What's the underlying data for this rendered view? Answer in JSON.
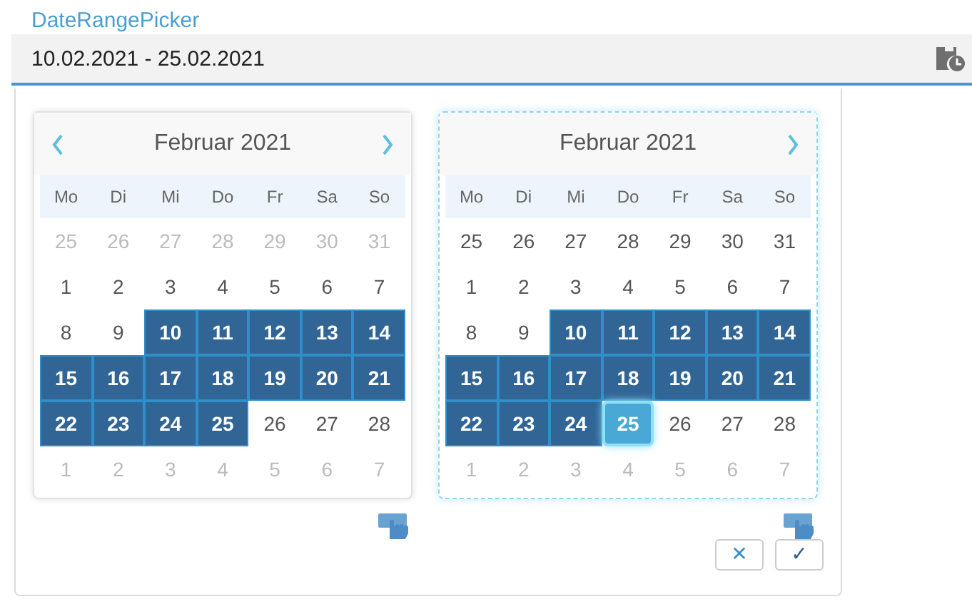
{
  "label": "DateRangePicker",
  "field": {
    "value": "10.02.2021 - 25.02.2021"
  },
  "calendars": [
    {
      "title": "Februar 2021",
      "prev": true,
      "next": true,
      "active": false,
      "weekdays": [
        "Mo",
        "Di",
        "Mi",
        "Do",
        "Fr",
        "Sa",
        "So"
      ],
      "weeks": [
        [
          {
            "day": "25",
            "outside": true,
            "selected": false,
            "focused": false
          },
          {
            "day": "26",
            "outside": true,
            "selected": false,
            "focused": false
          },
          {
            "day": "27",
            "outside": true,
            "selected": false,
            "focused": false
          },
          {
            "day": "28",
            "outside": true,
            "selected": false,
            "focused": false
          },
          {
            "day": "29",
            "outside": true,
            "selected": false,
            "focused": false
          },
          {
            "day": "30",
            "outside": true,
            "selected": false,
            "focused": false
          },
          {
            "day": "31",
            "outside": true,
            "selected": false,
            "focused": false
          }
        ],
        [
          {
            "day": "1",
            "outside": false,
            "selected": false,
            "focused": false
          },
          {
            "day": "2",
            "outside": false,
            "selected": false,
            "focused": false
          },
          {
            "day": "3",
            "outside": false,
            "selected": false,
            "focused": false
          },
          {
            "day": "4",
            "outside": false,
            "selected": false,
            "focused": false
          },
          {
            "day": "5",
            "outside": false,
            "selected": false,
            "focused": false
          },
          {
            "day": "6",
            "outside": false,
            "selected": false,
            "focused": false
          },
          {
            "day": "7",
            "outside": false,
            "selected": false,
            "focused": false
          }
        ],
        [
          {
            "day": "8",
            "outside": false,
            "selected": false,
            "focused": false
          },
          {
            "day": "9",
            "outside": false,
            "selected": false,
            "focused": false
          },
          {
            "day": "10",
            "outside": false,
            "selected": true,
            "focused": false
          },
          {
            "day": "11",
            "outside": false,
            "selected": true,
            "focused": false
          },
          {
            "day": "12",
            "outside": false,
            "selected": true,
            "focused": false
          },
          {
            "day": "13",
            "outside": false,
            "selected": true,
            "focused": false
          },
          {
            "day": "14",
            "outside": false,
            "selected": true,
            "focused": false
          }
        ],
        [
          {
            "day": "15",
            "outside": false,
            "selected": true,
            "focused": false
          },
          {
            "day": "16",
            "outside": false,
            "selected": true,
            "focused": false
          },
          {
            "day": "17",
            "outside": false,
            "selected": true,
            "focused": false
          },
          {
            "day": "18",
            "outside": false,
            "selected": true,
            "focused": false
          },
          {
            "day": "19",
            "outside": false,
            "selected": true,
            "focused": false
          },
          {
            "day": "20",
            "outside": false,
            "selected": true,
            "focused": false
          },
          {
            "day": "21",
            "outside": false,
            "selected": true,
            "focused": false
          }
        ],
        [
          {
            "day": "22",
            "outside": false,
            "selected": true,
            "focused": false
          },
          {
            "day": "23",
            "outside": false,
            "selected": true,
            "focused": false
          },
          {
            "day": "24",
            "outside": false,
            "selected": true,
            "focused": false
          },
          {
            "day": "25",
            "outside": false,
            "selected": true,
            "focused": false
          },
          {
            "day": "26",
            "outside": false,
            "selected": false,
            "focused": false
          },
          {
            "day": "27",
            "outside": false,
            "selected": false,
            "focused": false
          },
          {
            "day": "28",
            "outside": false,
            "selected": false,
            "focused": false
          }
        ],
        [
          {
            "day": "1",
            "outside": true,
            "selected": false,
            "focused": false
          },
          {
            "day": "2",
            "outside": true,
            "selected": false,
            "focused": false
          },
          {
            "day": "3",
            "outside": true,
            "selected": false,
            "focused": false
          },
          {
            "day": "4",
            "outside": true,
            "selected": false,
            "focused": false
          },
          {
            "day": "5",
            "outside": true,
            "selected": false,
            "focused": false
          },
          {
            "day": "6",
            "outside": true,
            "selected": false,
            "focused": false
          },
          {
            "day": "7",
            "outside": true,
            "selected": false,
            "focused": false
          }
        ]
      ]
    },
    {
      "title": "Februar 2021",
      "prev": false,
      "next": true,
      "active": true,
      "weekdays": [
        "Mo",
        "Di",
        "Mi",
        "Do",
        "Fr",
        "Sa",
        "So"
      ],
      "weeks": [
        [
          {
            "day": "25",
            "outside": false,
            "selected": false,
            "focused": false
          },
          {
            "day": "26",
            "outside": false,
            "selected": false,
            "focused": false
          },
          {
            "day": "27",
            "outside": false,
            "selected": false,
            "focused": false
          },
          {
            "day": "28",
            "outside": false,
            "selected": false,
            "focused": false
          },
          {
            "day": "29",
            "outside": false,
            "selected": false,
            "focused": false
          },
          {
            "day": "30",
            "outside": false,
            "selected": false,
            "focused": false
          },
          {
            "day": "31",
            "outside": false,
            "selected": false,
            "focused": false
          }
        ],
        [
          {
            "day": "1",
            "outside": false,
            "selected": false,
            "focused": false
          },
          {
            "day": "2",
            "outside": false,
            "selected": false,
            "focused": false
          },
          {
            "day": "3",
            "outside": false,
            "selected": false,
            "focused": false
          },
          {
            "day": "4",
            "outside": false,
            "selected": false,
            "focused": false
          },
          {
            "day": "5",
            "outside": false,
            "selected": false,
            "focused": false
          },
          {
            "day": "6",
            "outside": false,
            "selected": false,
            "focused": false
          },
          {
            "day": "7",
            "outside": false,
            "selected": false,
            "focused": false
          }
        ],
        [
          {
            "day": "8",
            "outside": false,
            "selected": false,
            "focused": false
          },
          {
            "day": "9",
            "outside": false,
            "selected": false,
            "focused": false
          },
          {
            "day": "10",
            "outside": false,
            "selected": true,
            "focused": false
          },
          {
            "day": "11",
            "outside": false,
            "selected": true,
            "focused": false
          },
          {
            "day": "12",
            "outside": false,
            "selected": true,
            "focused": false
          },
          {
            "day": "13",
            "outside": false,
            "selected": true,
            "focused": false
          },
          {
            "day": "14",
            "outside": false,
            "selected": true,
            "focused": false
          }
        ],
        [
          {
            "day": "15",
            "outside": false,
            "selected": true,
            "focused": false
          },
          {
            "day": "16",
            "outside": false,
            "selected": true,
            "focused": false
          },
          {
            "day": "17",
            "outside": false,
            "selected": true,
            "focused": false
          },
          {
            "day": "18",
            "outside": false,
            "selected": true,
            "focused": false
          },
          {
            "day": "19",
            "outside": false,
            "selected": true,
            "focused": false
          },
          {
            "day": "20",
            "outside": false,
            "selected": true,
            "focused": false
          },
          {
            "day": "21",
            "outside": false,
            "selected": true,
            "focused": false
          }
        ],
        [
          {
            "day": "22",
            "outside": false,
            "selected": true,
            "focused": false
          },
          {
            "day": "23",
            "outside": false,
            "selected": true,
            "focused": false
          },
          {
            "day": "24",
            "outside": false,
            "selected": true,
            "focused": false
          },
          {
            "day": "25",
            "outside": false,
            "selected": true,
            "focused": true
          },
          {
            "day": "26",
            "outside": false,
            "selected": false,
            "focused": false
          },
          {
            "day": "27",
            "outside": false,
            "selected": false,
            "focused": false
          },
          {
            "day": "28",
            "outside": false,
            "selected": false,
            "focused": false
          }
        ],
        [
          {
            "day": "1",
            "outside": true,
            "selected": false,
            "focused": false
          },
          {
            "day": "2",
            "outside": true,
            "selected": false,
            "focused": false
          },
          {
            "day": "3",
            "outside": true,
            "selected": false,
            "focused": false
          },
          {
            "day": "4",
            "outside": true,
            "selected": false,
            "focused": false
          },
          {
            "day": "5",
            "outside": true,
            "selected": false,
            "focused": false
          },
          {
            "day": "6",
            "outside": true,
            "selected": false,
            "focused": false
          },
          {
            "day": "7",
            "outside": true,
            "selected": false,
            "focused": false
          }
        ]
      ]
    }
  ],
  "buttons": [
    {
      "kind": "cancel",
      "label": "✕"
    },
    {
      "kind": "confirm",
      "label": "✓"
    }
  ]
}
